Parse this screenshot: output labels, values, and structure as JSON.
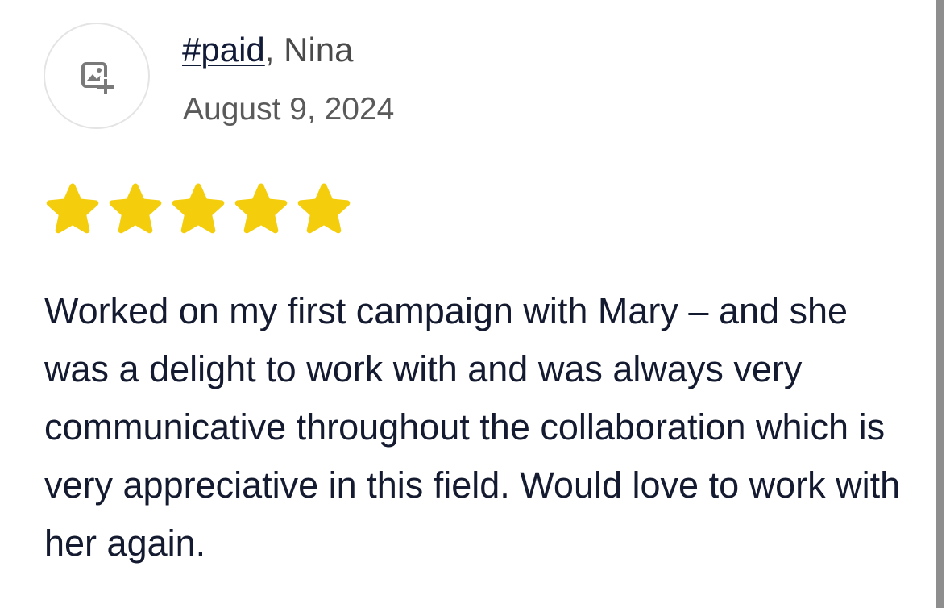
{
  "review": {
    "hashtag": "#paid",
    "separator": ",",
    "author": "Nina",
    "date": "August 9, 2024",
    "rating": 5,
    "rating_max": 5,
    "text": "Worked on my first campaign with Mary – and she was a delight to work with and was always very communicative throughout the collaboration which is very appreciative in this field. Would love to work with her again."
  },
  "icons": {
    "avatar": "add-photo-icon",
    "rating": "star-icon"
  },
  "colors": {
    "star": "#f4ce0d",
    "text": "#141a2f",
    "muted": "#5a5a5a",
    "border": "#e4e4e4"
  }
}
